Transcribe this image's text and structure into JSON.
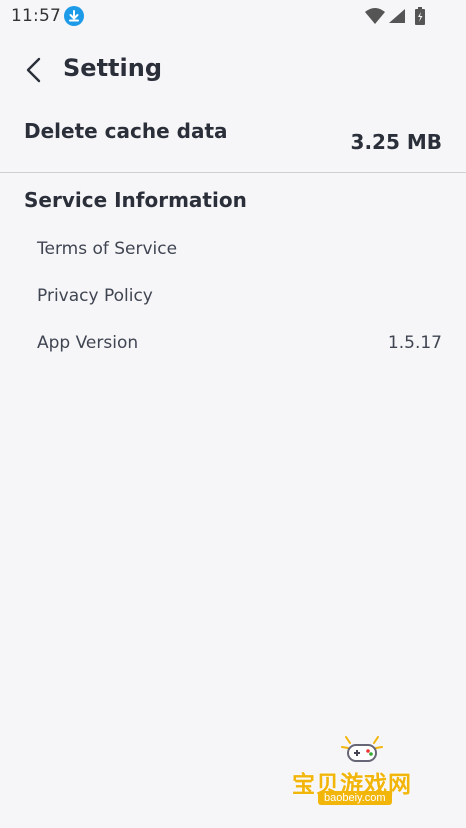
{
  "status_bar": {
    "time": "11:57"
  },
  "header": {
    "title": "Setting"
  },
  "cache": {
    "label": "Delete cache data",
    "value": "3.25 MB"
  },
  "service": {
    "section_title": "Service Information",
    "items": [
      {
        "label": "Terms of Service",
        "value": ""
      },
      {
        "label": "Privacy Policy",
        "value": ""
      },
      {
        "label": "App Version",
        "value": "1.5.17"
      }
    ]
  },
  "watermark": {
    "text": "宝贝游戏网",
    "url": "baobeiy.com"
  },
  "colors": {
    "background": "#f6f6f8",
    "text": "#2b2f3a",
    "accent": "#1e9be8",
    "watermark": "#f2b50a"
  }
}
